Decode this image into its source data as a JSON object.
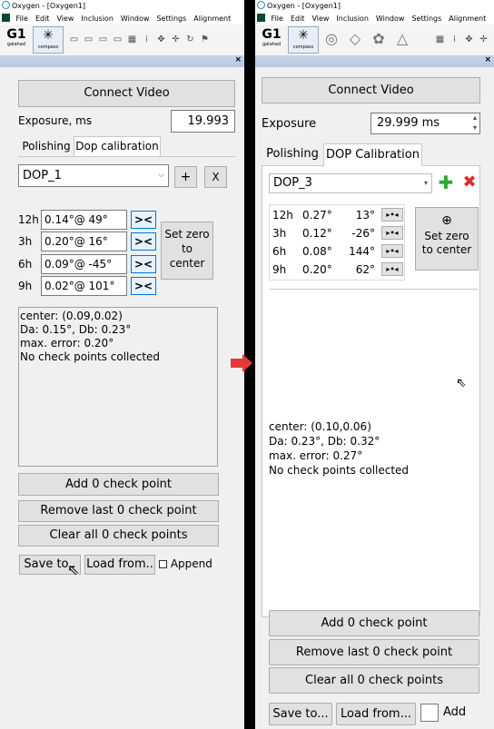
{
  "window1": {
    "title": "Oxygen - [Oxygen1]",
    "menu": [
      "File",
      "Edit",
      "View",
      "Inclusion",
      "Window",
      "Settings",
      "Alignment"
    ],
    "toolbar": {
      "g1_label": "G1",
      "g1_sub": "galahad",
      "compass_sub": "compass"
    },
    "dock_close": "×",
    "connect_video": "Connect Video",
    "exposure_label": "Exposure, ms",
    "exposure_value": "19.993",
    "tabs": [
      "Polishing",
      "Dop calibration"
    ],
    "dop_select": "DOP_1",
    "add_btn": "+",
    "remove_btn": "X",
    "rows": [
      {
        "h": "12h",
        "val": "0.14°@  49°",
        "btn": "><"
      },
      {
        "h": "3h",
        "val": "0.20°@  16°",
        "btn": "><"
      },
      {
        "h": "6h",
        "val": "0.09°@ -45°",
        "btn": "><"
      },
      {
        "h": "9h",
        "val": "0.02°@ 101°",
        "btn": "><"
      }
    ],
    "set_zero": [
      "Set zero",
      "to",
      "center"
    ],
    "info": [
      "center: (0.09,0.02)",
      "Da: 0.15°, Db: 0.23°",
      "max. error: 0.20°",
      "No check points collected"
    ],
    "add_check": "Add 0 check point",
    "remove_last": "Remove last 0 check point",
    "clear_all": "Clear all 0 check points",
    "save_to": "Save to..",
    "load_from": "Load from..",
    "append": "Append"
  },
  "window2": {
    "title": "Oxygen - [Oxygen1]",
    "menu": [
      "File",
      "Edit",
      "View",
      "Inclusion",
      "Window",
      "Settings",
      "Alignment"
    ],
    "toolbar": {
      "g1_label": "G1",
      "g1_sub": "galahad",
      "compass_sub": "compass"
    },
    "dock_close": "×",
    "connect_video": "Connect Video",
    "exposure_label": "Exposure",
    "exposure_value": "29.999 ms",
    "tabs": [
      "Polishing",
      "DOP Calibration"
    ],
    "dop_select": "DOP_3",
    "rows": [
      {
        "h": "12h",
        "val": "0.27°",
        "ang": "13°"
      },
      {
        "h": "3h",
        "val": "0.12°",
        "ang": "-26°"
      },
      {
        "h": "6h",
        "val": "0.08°",
        "ang": "144°"
      },
      {
        "h": "9h",
        "val": "0.20°",
        "ang": "62°"
      }
    ],
    "set_zero": [
      "Set zero",
      "to center"
    ],
    "info": [
      "center: (0.10,0.06)",
      "Da: 0.23°, Db: 0.32°",
      "max. error: 0.27°",
      "No check points collected"
    ],
    "add_check": "Add 0 check point",
    "remove_last": "Remove last 0 check point",
    "clear_all": "Clear all 0 check points",
    "save_to": "Save to...",
    "load_from": "Load from...",
    "append": "Add"
  },
  "colors": {
    "arrow": "#e53935",
    "add_green": "#2eaa2e",
    "remove_red": "#d63030"
  }
}
